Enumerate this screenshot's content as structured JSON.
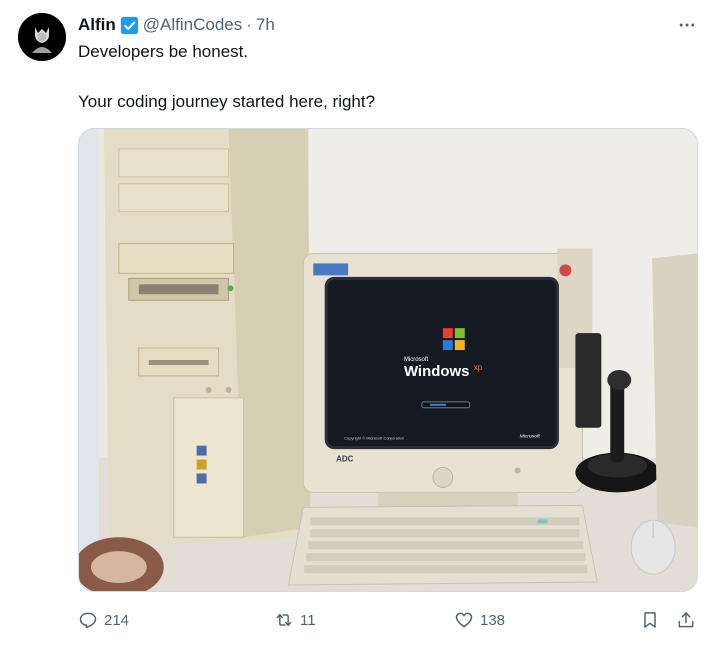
{
  "tweet": {
    "author_name": "Alfin",
    "author_handle": "@AlfinCodes",
    "separator": "·",
    "time_ago": "7h",
    "verified_icon": "verified-badge-icon",
    "more_icon": "more-horizontal-icon",
    "text_line_1": "Developers be honest.",
    "text_line_2": "Your coding journey started here, right?",
    "media_description_icon": "photo",
    "screen_text": {
      "brand_small": "Microsoft",
      "brand_large": "Windows",
      "brand_sup": "xp",
      "copyright": "Copyright © Microsoft Corporation",
      "corner_logo": "Microsoft",
      "monitor_brand": "ADC"
    }
  },
  "actions": {
    "reply": {
      "icon": "reply-icon",
      "count": "214"
    },
    "retweet": {
      "icon": "retweet-icon",
      "count": "11"
    },
    "like": {
      "icon": "heart-icon",
      "count": "138"
    },
    "bookmark": {
      "icon": "bookmark-icon"
    },
    "share": {
      "icon": "share-icon"
    }
  },
  "colors": {
    "verified_blue": "#1d9bf0",
    "text_primary": "#0f1419",
    "text_secondary": "#536471"
  }
}
